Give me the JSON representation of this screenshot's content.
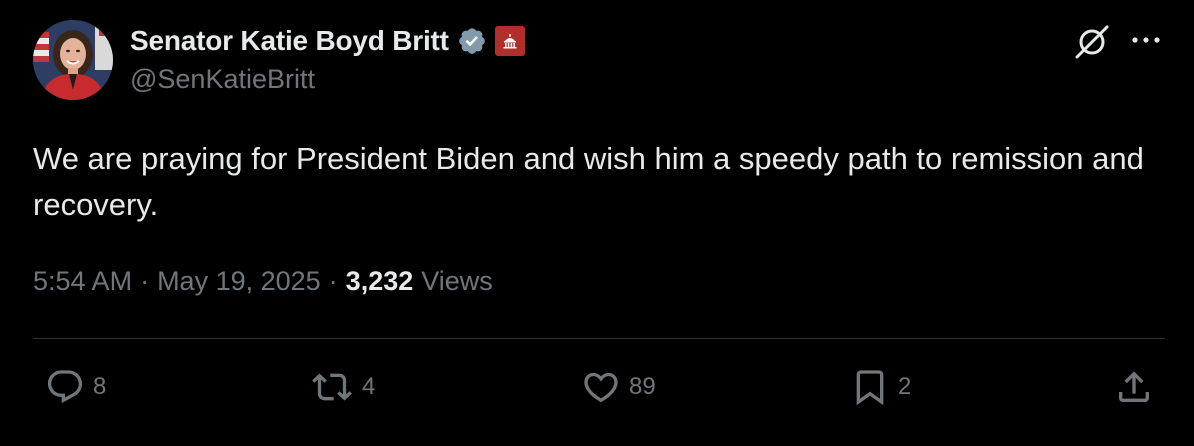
{
  "author": {
    "display_name": "Senator Katie Boyd Britt",
    "handle": "@SenKatieBritt"
  },
  "tweet": {
    "text": "We are praying for President Biden and wish him a speedy path to remission and recovery."
  },
  "meta": {
    "time": "5:54 AM",
    "separator": "·",
    "date": "May 19, 2025",
    "views_count": "3,232",
    "views_label": "Views"
  },
  "actions": {
    "replies": "8",
    "reposts": "4",
    "likes": "89",
    "bookmarks": "2"
  },
  "colors": {
    "background": "#000000",
    "text_primary": "#e7e9ea",
    "text_secondary": "#71767b",
    "verified_badge": "#829aab",
    "affiliation_badge": "#b12f2b",
    "divider": "#2f3336"
  },
  "icons": {
    "verified": "verified-badge-icon",
    "affiliation": "capitol-building-icon",
    "grok": "grok-icon",
    "more": "more-icon",
    "reply": "reply-icon",
    "repost": "repost-icon",
    "like": "heart-icon",
    "bookmark": "bookmark-icon",
    "share": "share-icon"
  }
}
